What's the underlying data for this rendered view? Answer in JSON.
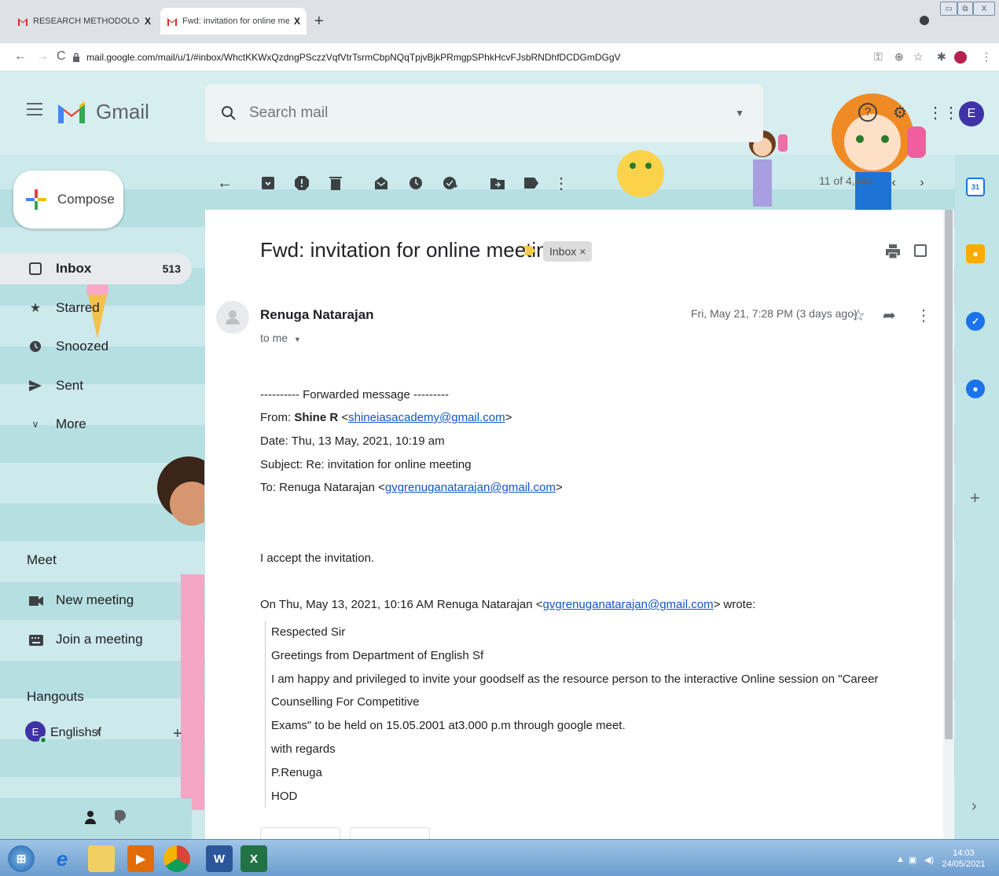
{
  "browser": {
    "tabs": [
      {
        "title": "RESEARCH METHODOLOGY - SYL",
        "close": "X"
      },
      {
        "title": "Fwd: invitation for online meeting",
        "close": "X"
      }
    ],
    "new_tab": "+",
    "url": "mail.google.com/mail/u/1/#inbox/WhctKKWxQzdngPSczzVqfVtrTsrmCbpNQqTpjvBjkPRmgpSPhkHcvFJsbRNDhfDCDGmDGgV",
    "nav": {
      "back": "←",
      "forward": "→",
      "reload": "C"
    },
    "window_controls": {
      "min": "▭",
      "max": "⧉",
      "close": "X"
    }
  },
  "gmail": {
    "logo_text": "Gmail",
    "search": {
      "placeholder": "Search mail"
    },
    "account_initial": "E",
    "compose_label": "Compose",
    "nav": [
      {
        "label": "Inbox",
        "count": "513",
        "icon": "inbox-icon"
      },
      {
        "label": "Starred",
        "icon": "star-icon"
      },
      {
        "label": "Snoozed",
        "icon": "clock-icon"
      },
      {
        "label": "Sent",
        "icon": "send-icon"
      },
      {
        "label": "More",
        "icon": "chevron-down-icon"
      }
    ],
    "meet": {
      "heading": "Meet",
      "new_meeting": "New meeting",
      "join_meeting": "Join a meeting"
    },
    "hangouts": {
      "heading": "Hangouts",
      "user_initial": "E",
      "user_name": "Englishsf",
      "add": "+"
    },
    "toolbar": {
      "counter": "11 of 4,444"
    },
    "message": {
      "subject": "Fwd: invitation for online meeting",
      "label_chip": "Inbox",
      "label_chip_close": "×",
      "sender": "Renuga Natarajan",
      "to_line": "to me",
      "date": "Fri, May 21, 7:28 PM (3 days ago)",
      "forward_header": "---------- Forwarded message ---------",
      "from_prefix": "From: ",
      "from_name": "Shine R",
      "from_email": "shineiasacademy@gmail.com",
      "date_line": "Date: Thu, 13 May, 2021, 10:19 am",
      "subject_line": "Subject: Re: invitation for online meeting",
      "to_prefix": "To: Renuga Natarajan <",
      "to_email": "gvgrenuganatarajan@gmail.com",
      "reply_text": "I accept the invitation.",
      "quote_intro_prefix": "On Thu, May 13, 2021, 10:16 AM Renuga Natarajan <",
      "quote_intro_email": "gvgrenuganatarajan@gmail.com",
      "quote_intro_suffix": "> wrote:",
      "quote_lines": [
        "Respected Sir",
        "Greetings from Department of English Sf",
        "I am happy and privileged to invite your goodself as the resource person to the interactive Online session on \"Career Counselling For Competitive",
        "Exams\" to be held on 15.05.2001 at3.000 p.m through google meet.",
        "with regards",
        "P.Renuga",
        "HOD"
      ]
    },
    "side_panel": {
      "calendar_day": "31",
      "expand": "+",
      "collapse": "›"
    }
  },
  "taskbar": {
    "time": "14:03",
    "date": "24/05/2021"
  },
  "colors": {
    "accent": "#1a73e8",
    "theme_bg": "#cce9ec",
    "avatar": "#3f33a7",
    "link": "#1155cc"
  }
}
